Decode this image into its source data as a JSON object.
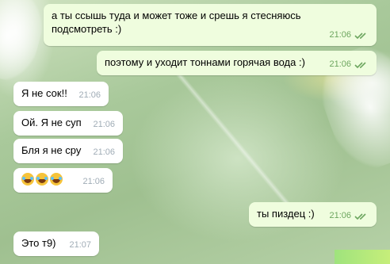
{
  "messages": [
    {
      "text": "а ты ссышь туда и может тоже и срешь я стесняюсь подсмотреть :)",
      "time": "21:06",
      "dir": "out",
      "read": true
    },
    {
      "text": "поэтому и уходит тоннами горячая вода :)",
      "time": "21:06",
      "dir": "out",
      "read": true
    },
    {
      "text": "Я не сок!!",
      "time": "21:06",
      "dir": "in"
    },
    {
      "text": "Ой. Я не суп",
      "time": "21:06",
      "dir": "in"
    },
    {
      "text": "Бля я не сру",
      "time": "21:06",
      "dir": "in"
    },
    {
      "text": "",
      "time": "21:06",
      "dir": "in",
      "emoji": [
        "laughing-tears-emoji",
        "laughing-tears-emoji",
        "laughing-tears-emoji"
      ]
    },
    {
      "text": "ты пиздец :)",
      "time": "21:06",
      "dir": "out",
      "read": true
    },
    {
      "text": "Это т9)",
      "time": "21:07",
      "dir": "in"
    }
  ],
  "colors": {
    "outgoing_bubble": "#effdde",
    "incoming_bubble": "#ffffff",
    "read_check": "#6da65f"
  }
}
